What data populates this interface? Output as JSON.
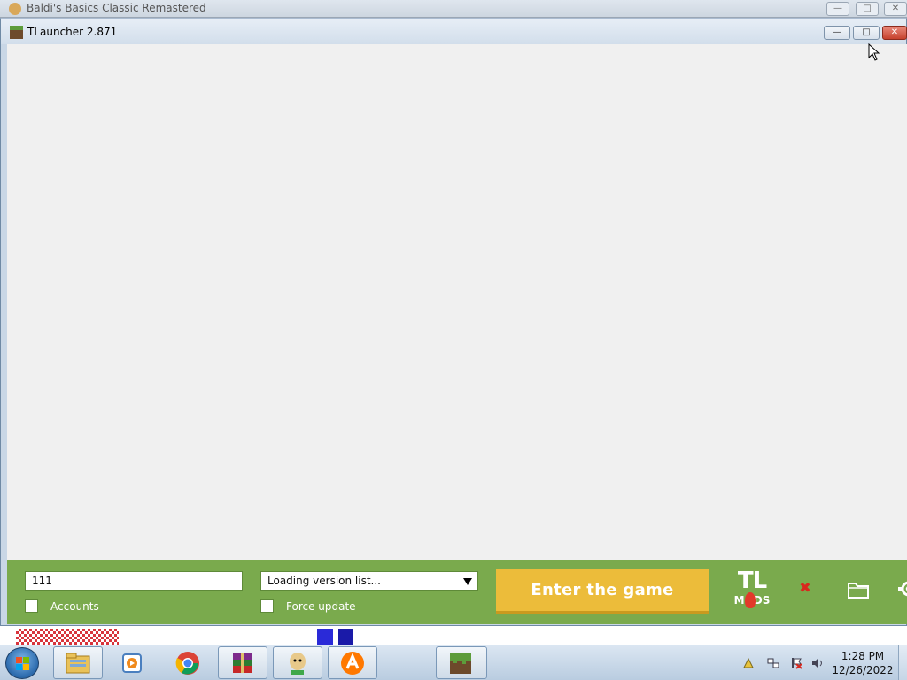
{
  "background_window": {
    "title": "Baldi's Basics Classic Remastered"
  },
  "window": {
    "title": "TLauncher 2.871",
    "controls": {
      "minimize": "—",
      "maximize": "□",
      "close": "✕"
    }
  },
  "panel": {
    "username_value": "111",
    "version_select_value": "Loading version list...",
    "accounts_label": "Accounts",
    "force_update_label": "Force update",
    "enter_button_label": "Enter the game",
    "tlmods_logo": {
      "line1": "TL",
      "line2": "MODS"
    },
    "icons": [
      "red-x-icon",
      "folder-icon",
      "gear-icon"
    ]
  },
  "taskbar": {
    "apps": [
      "windows-explorer",
      "media-player",
      "chrome",
      "winrar",
      "baldi-game",
      "avast",
      "minecraft"
    ],
    "clock_time": "1:28 PM",
    "clock_date": "12/26/2022"
  },
  "colors": {
    "panel_green": "#7aaa4d",
    "enter_button": "#ecbc3a",
    "content_bg": "#f0f0f0"
  }
}
